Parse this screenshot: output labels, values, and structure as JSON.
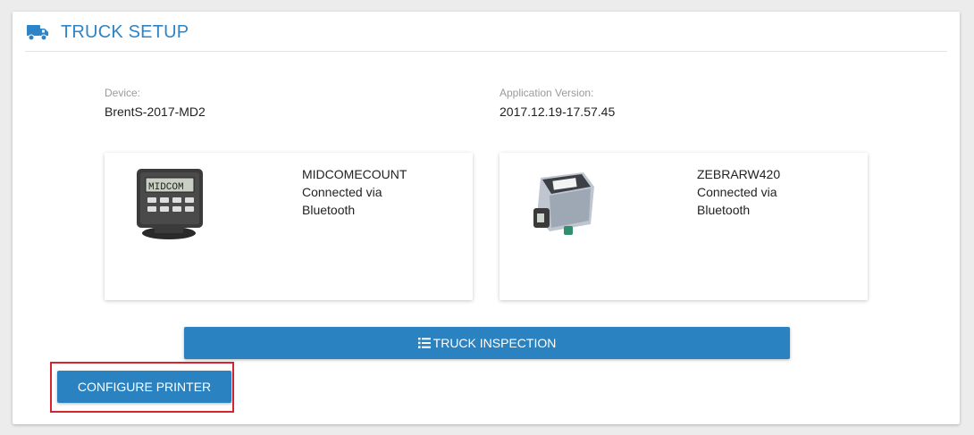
{
  "header": {
    "title": "TRUCK SETUP",
    "icon": "truck-icon"
  },
  "info": {
    "device_label": "Device:",
    "device_value": "BrentS-2017-MD2",
    "version_label": "Application Version:",
    "version_value": "2017.12.19-17.57.45"
  },
  "devices": [
    {
      "name": "MIDCOMECOUNT",
      "status_line1": "Connected via",
      "status_line2": "Bluetooth",
      "image": "meter-device-image"
    },
    {
      "name": "ZEBRARW420",
      "status_line1": "Connected via",
      "status_line2": "Bluetooth",
      "image": "printer-device-image"
    }
  ],
  "buttons": {
    "truck_inspection": "TRUCK INSPECTION",
    "configure_printer": "CONFIGURE PRINTER"
  },
  "colors": {
    "accent": "#2e84c6",
    "button": "#2a82c0",
    "highlight": "#d9232d"
  }
}
